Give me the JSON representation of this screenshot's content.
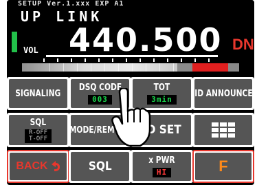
{
  "display": {
    "status_line": "SETUP   Ver.1.xxx EXP A1",
    "title": "UP LINK",
    "vol_label": "VOL",
    "frequency": "440.500",
    "mode_indicator": "DN"
  },
  "buttons": {
    "signaling": "SIGNALING",
    "dsq_code": "DSQ CODE",
    "dsq_code_value": "003",
    "tot": "TOT",
    "tot_value": "3min",
    "id_announce": "ID ANNOUNCE",
    "sql": "SQL",
    "sql_status": "R-OFF\nT-OFF",
    "mode_remote": "MODE/REMOTE",
    "id_set": "ID SET",
    "back": "BACK",
    "sql_big": "SQL",
    "tx_pwr": "x PWR",
    "tx_pwr_value": "HI",
    "f": "F"
  },
  "colors": {
    "screen_bg": "#000000",
    "button_face": "#555555",
    "accent_red": "#e8372d",
    "value_green": "#19d84c",
    "f_orange": "#ff8a1a",
    "volume_indicator": "#22c04a"
  },
  "icons": {
    "menu_grid": "grid-icon",
    "back_arrow": "return-arrow-icon",
    "touch_hand": "pointing-hand-icon"
  }
}
